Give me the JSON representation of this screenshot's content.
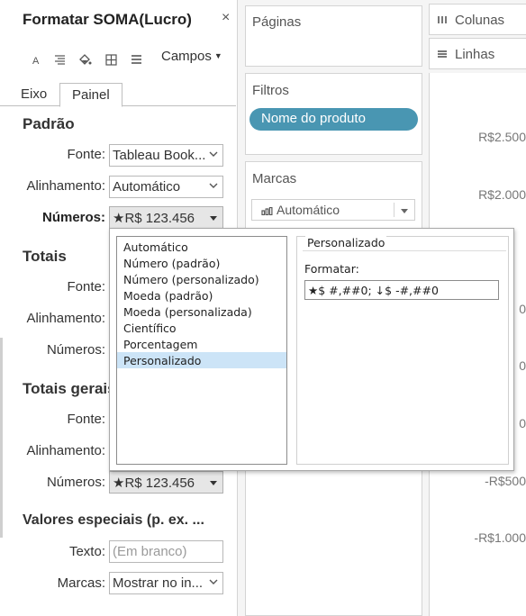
{
  "format_pane": {
    "title": "Formatar SOMA(Lucro)",
    "close_glyph": "×",
    "toolbar": {
      "icons": [
        "font-icon",
        "align-icon",
        "shading-icon",
        "borders-icon",
        "lines-icon"
      ],
      "fields_label": "Campos"
    },
    "tabs": [
      {
        "label": "Eixo",
        "active": false
      },
      {
        "label": "Painel",
        "active": true
      }
    ],
    "sections": {
      "default": {
        "title": "Padrão",
        "font_label": "Fonte:",
        "font_value": "Tableau Book...",
        "alignment_label": "Alinhamento:",
        "alignment_value": "Automático",
        "numbers_label": "Números:",
        "numbers_value": "★R$ 123.456"
      },
      "totals": {
        "title": "Totais",
        "font_label": "Fonte:",
        "alignment_label": "Alinhamento:",
        "numbers_label": "Números:"
      },
      "grand_totals": {
        "title": "Totais gerais",
        "font_label": "Fonte:",
        "alignment_label": "Alinhamento:",
        "numbers_label": "Números:",
        "numbers_value": "★R$ 123.456"
      },
      "special_values": {
        "title": "Valores especiais (p. ex. ...",
        "text_label": "Texto:",
        "text_placeholder": "(Em branco)",
        "marks_label": "Marcas:",
        "marks_value": "Mostrar no in..."
      }
    }
  },
  "shelves": {
    "pages": "Páginas",
    "filters": "Filtros",
    "filter_pill": "Nome do produto",
    "marks": "Marcas",
    "marks_type": "Automático",
    "columns": "Colunas",
    "rows": "Linhas"
  },
  "axis_labels": [
    "R$2.500",
    "R$2.000",
    "0",
    "0",
    "0",
    "-R$500",
    "-R$1.000"
  ],
  "number_popup": {
    "formats": [
      {
        "label": "Automático",
        "selected": false
      },
      {
        "label": "Número (padrão)",
        "selected": false
      },
      {
        "label": "Número (personalizado)",
        "selected": false
      },
      {
        "label": "Moeda (padrão)",
        "selected": false
      },
      {
        "label": "Moeda (personalizada)",
        "selected": false
      },
      {
        "label": "Científico",
        "selected": false
      },
      {
        "label": "Porcentagem",
        "selected": false
      },
      {
        "label": "Personalizado",
        "selected": true
      }
    ],
    "custom_group_label": "Personalizado",
    "format_label": "Formatar:",
    "format_value": "★$ #,##0; ↓$ -#,##0"
  },
  "colors": {
    "pill_blue": "#4996b2",
    "selection_blue": "#cce4f7",
    "shelf_background": "#f5f5f5"
  }
}
